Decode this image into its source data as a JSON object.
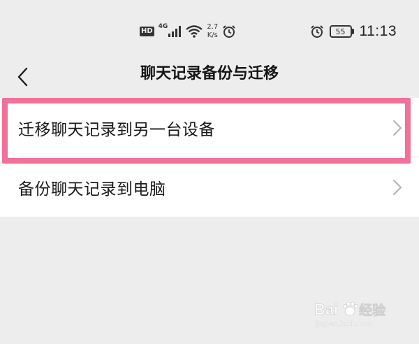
{
  "status_bar": {
    "hd_badge": "HD",
    "network_type": "4G",
    "speed_value": "2.7",
    "speed_unit": "K/s",
    "battery_level": "55",
    "time": "11:13",
    "icons": [
      "hd-icon",
      "signal-icon",
      "wifi-icon",
      "alarm-icon",
      "battery-icon"
    ]
  },
  "nav": {
    "back_icon": "chevron-left-icon",
    "title": "聊天记录备份与迁移"
  },
  "list": {
    "items": [
      {
        "label": "迁移聊天记录到另一台设备",
        "icon": "chevron-right-icon"
      },
      {
        "label": "备份聊天记录到电脑",
        "icon": "chevron-right-icon"
      }
    ]
  },
  "highlight": {
    "color": "#f17198"
  },
  "watermark": {
    "brand": "Baidu经验",
    "url": "jingyan.baidu.com"
  },
  "colors": {
    "background": "#ededed",
    "list_background": "#ffffff",
    "text": "#1a1a1a",
    "chevron": "#b2b2b2"
  }
}
